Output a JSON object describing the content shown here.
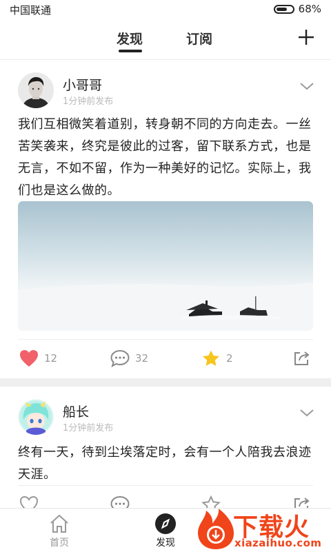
{
  "status": {
    "carrier": "中国联通",
    "battery": "68%",
    "battery_level": 0.68
  },
  "nav": {
    "tabs": [
      {
        "label": "发现",
        "active": true
      },
      {
        "label": "订阅",
        "active": false
      }
    ]
  },
  "posts": [
    {
      "user": "小哥哥",
      "time": "1分钟前发布",
      "text": "我们互相微笑着道别，转身朝不同的方向走去。一丝苦笑袭来，终究是彼此的过客，留下联系方式，也是无言，不如不留，作为一种美好的记忆。实际上，我们也是这么做的。",
      "likes": "12",
      "comments": "32",
      "stars": "2"
    },
    {
      "user": "船长",
      "time": "1分钟前发布",
      "text": "终有一天，待到尘埃落定时，会有一个人陪我去浪迹天涯。"
    }
  ],
  "bottom_nav": [
    {
      "label": "首页"
    },
    {
      "label": "发现"
    }
  ],
  "watermark": {
    "title": "下载火",
    "url": "xiazaihuo.com"
  },
  "colors": {
    "like": "#f0616a",
    "star": "#f7c51e",
    "accent": "#f0441a"
  }
}
